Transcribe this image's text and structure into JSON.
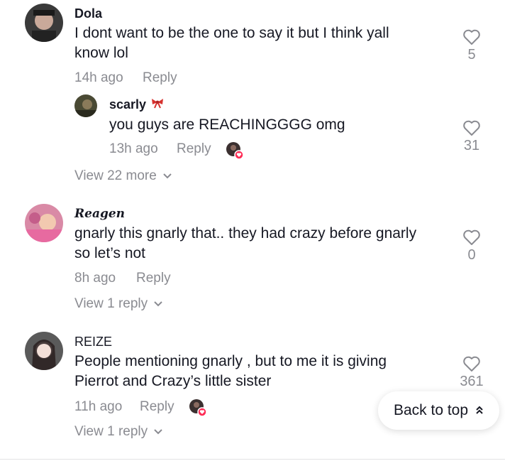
{
  "comments": [
    {
      "username": "Dola",
      "lines": [
        "I dont want to be the one to say it but I think yall",
        "know lol"
      ],
      "time": "14h ago",
      "reply_label": "Reply",
      "likes": "5",
      "avatar_color": "#3a3a3a"
    },
    {
      "username": "scarly",
      "badge_icon": "bow-icon",
      "lines": [
        "you guys are REACHINGGGG omg"
      ],
      "time": "13h ago",
      "reply_label": "Reply",
      "likes": "31",
      "avatar_color": "#4a4a34"
    },
    {
      "username": "Reagen",
      "lines": [
        "gnarly this gnarly that.. they had crazy before gnarly",
        "so let’s not"
      ],
      "time": "8h ago",
      "reply_label": "Reply",
      "likes": "0",
      "avatar_color": "#d98aa6"
    },
    {
      "username": "REIZE",
      "lines": [
        "People mentioning gnarly , but to me it is giving",
        "Pierrot and Crazy’s little sister"
      ],
      "time": "11h ago",
      "reply_label": "Reply",
      "likes": "361",
      "avatar_color": "#5a5a5a"
    }
  ],
  "view_more": [
    "View 22 more",
    "View 1 reply",
    "View 1 reply"
  ],
  "back_to_top": "Back to top",
  "colors": {
    "muted": "#8a8b91",
    "text": "#161823",
    "liked_badge": "#fe2c55"
  }
}
